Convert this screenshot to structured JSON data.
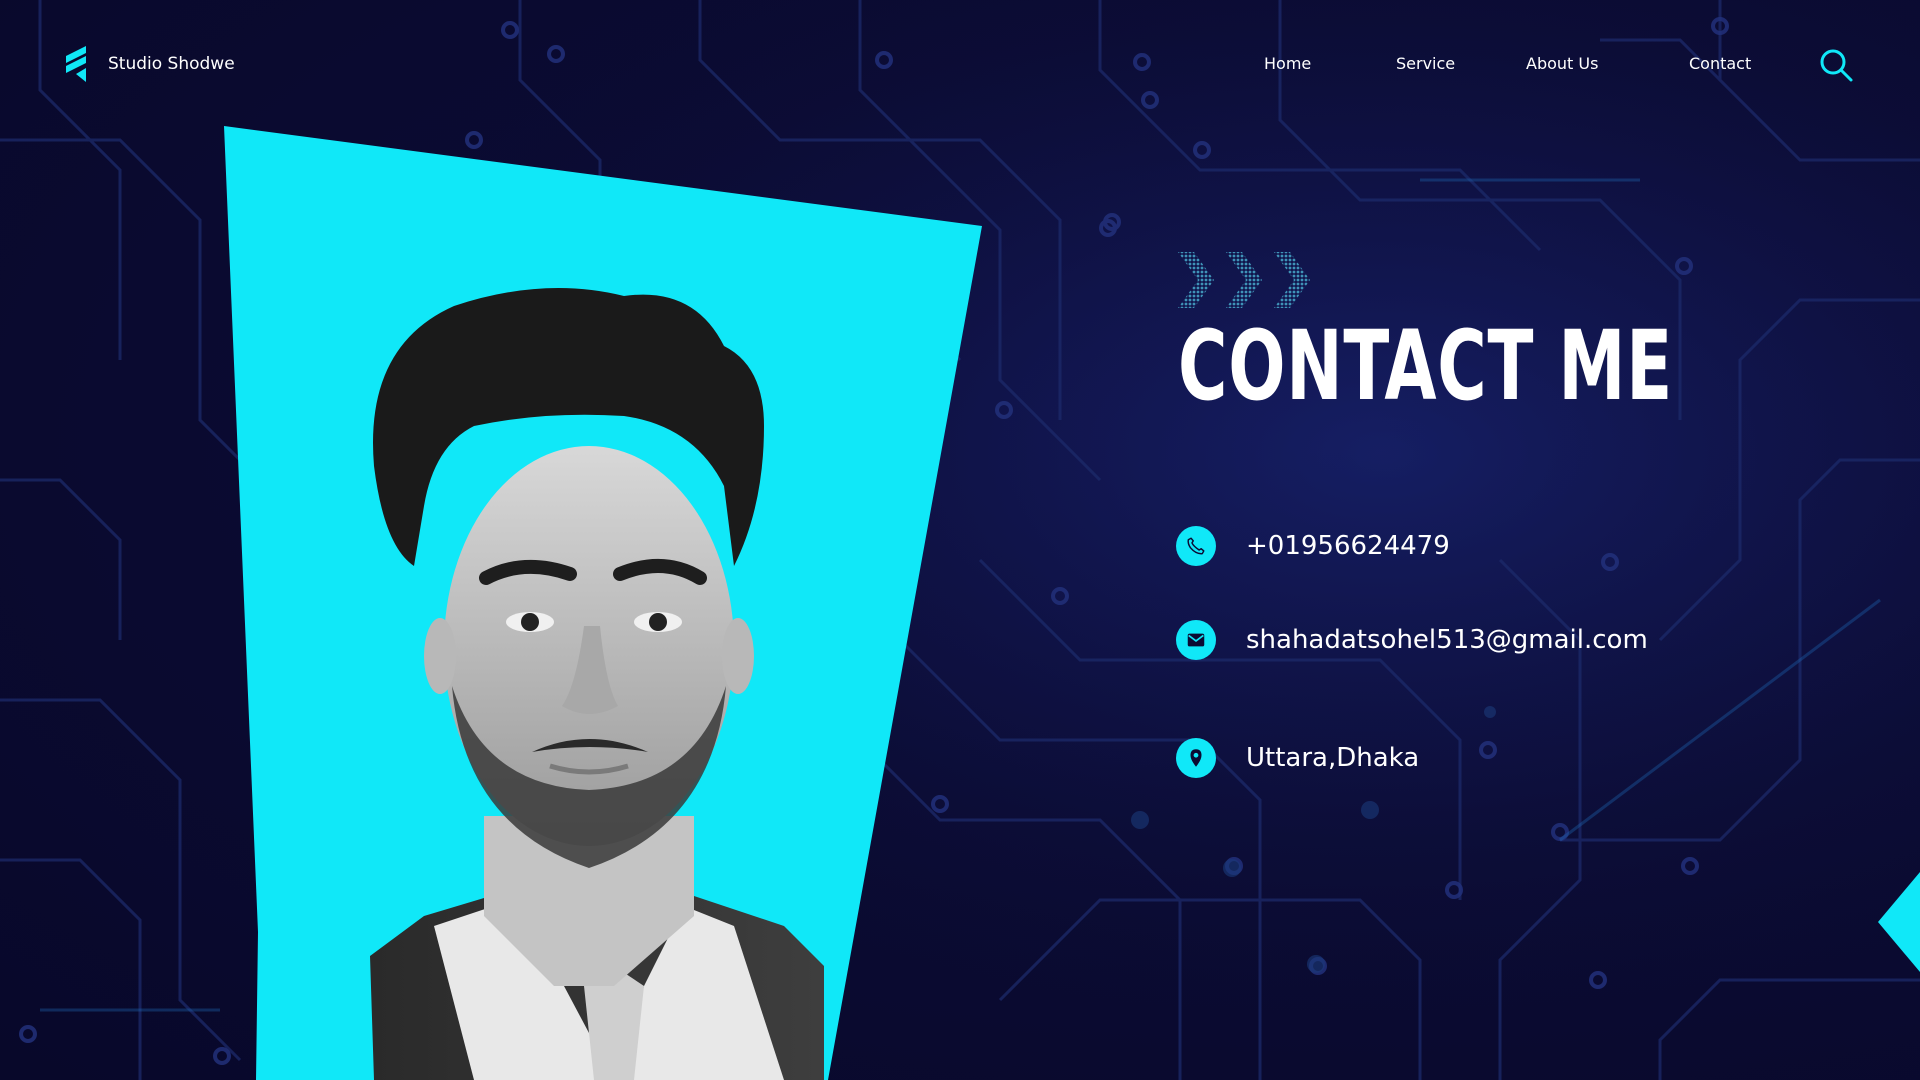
{
  "brand": {
    "name": "Studio Shodwe",
    "accent_color": "#10e8f8",
    "background_color": "#0b0b33"
  },
  "nav": {
    "items": [
      {
        "label": "Home"
      },
      {
        "label": "Service"
      },
      {
        "label": "About Us"
      },
      {
        "label": "Contact"
      }
    ],
    "search_icon": "search-icon"
  },
  "hero": {
    "title": "CONTACT ME",
    "decoration_icon": "triple-chevron-right-icon"
  },
  "contacts": [
    {
      "icon": "phone-icon",
      "text": "+01956624479"
    },
    {
      "icon": "mail-icon",
      "text": "shahadatsohel513@gmail.com"
    },
    {
      "icon": "location-pin-icon",
      "text": "Uttara,Dhaka"
    }
  ],
  "photo": {
    "description_icon": "portrait-photo",
    "frame_color": "#10e8f8"
  }
}
